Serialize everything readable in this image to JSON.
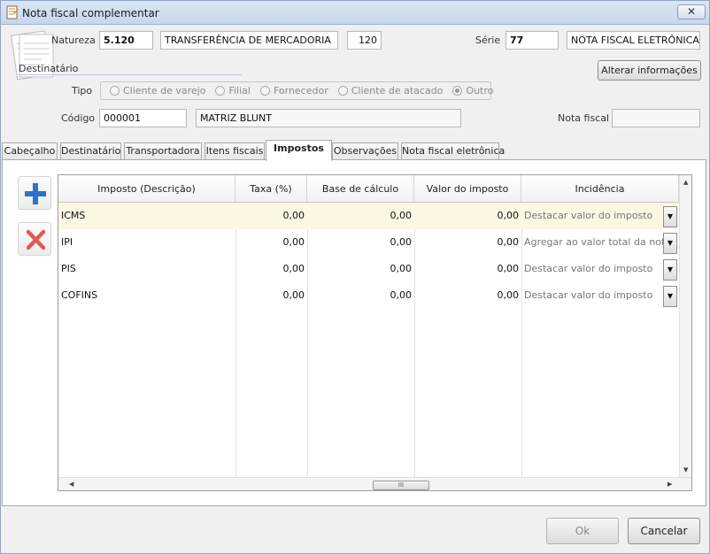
{
  "window": {
    "title": "Nota fiscal complementar",
    "close_label": "✕"
  },
  "header": {
    "natureza_label": "Natureza",
    "natureza_code": "5.120",
    "natureza_desc": "TRANSFERÊNCIA DE MERCADORIA",
    "natureza_num": "120",
    "serie_label": "Série",
    "serie_code": "77",
    "serie_desc": "NOTA FISCAL ELETRÔNICA",
    "destinatario_label": "Destinatário",
    "alterar_label": "Alterar informações",
    "tipo_label": "Tipo",
    "tipo_options": [
      "Cliente de varejo",
      "Filial",
      "Fornecedor",
      "Cliente de atacado",
      "Outro"
    ],
    "tipo_selected": "Outro",
    "codigo_label": "Código",
    "codigo_value": "000001",
    "codigo_name": "MATRIZ BLUNT",
    "nota_fiscal_label": "Nota fiscal",
    "nota_fiscal_value": ""
  },
  "tabs": [
    {
      "label": "Cabeçalho"
    },
    {
      "label": "Destinatário"
    },
    {
      "label": "Transportadora"
    },
    {
      "label": "Itens fiscais"
    },
    {
      "label": "Impostos"
    },
    {
      "label": "Observações"
    },
    {
      "label": "Nota fiscal eletrônica"
    }
  ],
  "active_tab": "Impostos",
  "grid": {
    "columns": [
      "Imposto (Descrição)",
      "Taxa (%)",
      "Base de cálculo",
      "Valor do imposto",
      "Incidência"
    ],
    "rows": [
      {
        "imposto": "ICMS",
        "taxa": "0,00",
        "base": "0,00",
        "valor": "0,00",
        "incidencia": "Destacar valor do imposto"
      },
      {
        "imposto": "IPI",
        "taxa": "0,00",
        "base": "0,00",
        "valor": "0,00",
        "incidencia": "Agregar ao valor total da nota"
      },
      {
        "imposto": "PIS",
        "taxa": "0,00",
        "base": "0,00",
        "valor": "0,00",
        "incidencia": "Destacar valor do imposto"
      },
      {
        "imposto": "COFINS",
        "taxa": "0,00",
        "base": "0,00",
        "valor": "0,00",
        "incidencia": "Destacar valor do imposto"
      }
    ],
    "scroll_thumb_label": "III"
  },
  "footer": {
    "ok_label": "Ok",
    "cancel_label": "Cancelar"
  },
  "icons": {
    "add": "plus-icon",
    "remove": "x-icon",
    "document": "document-icon"
  },
  "colors": {
    "add": "#2a73c8",
    "remove": "#e05a55",
    "highlight_row": "#fcf7e3"
  }
}
